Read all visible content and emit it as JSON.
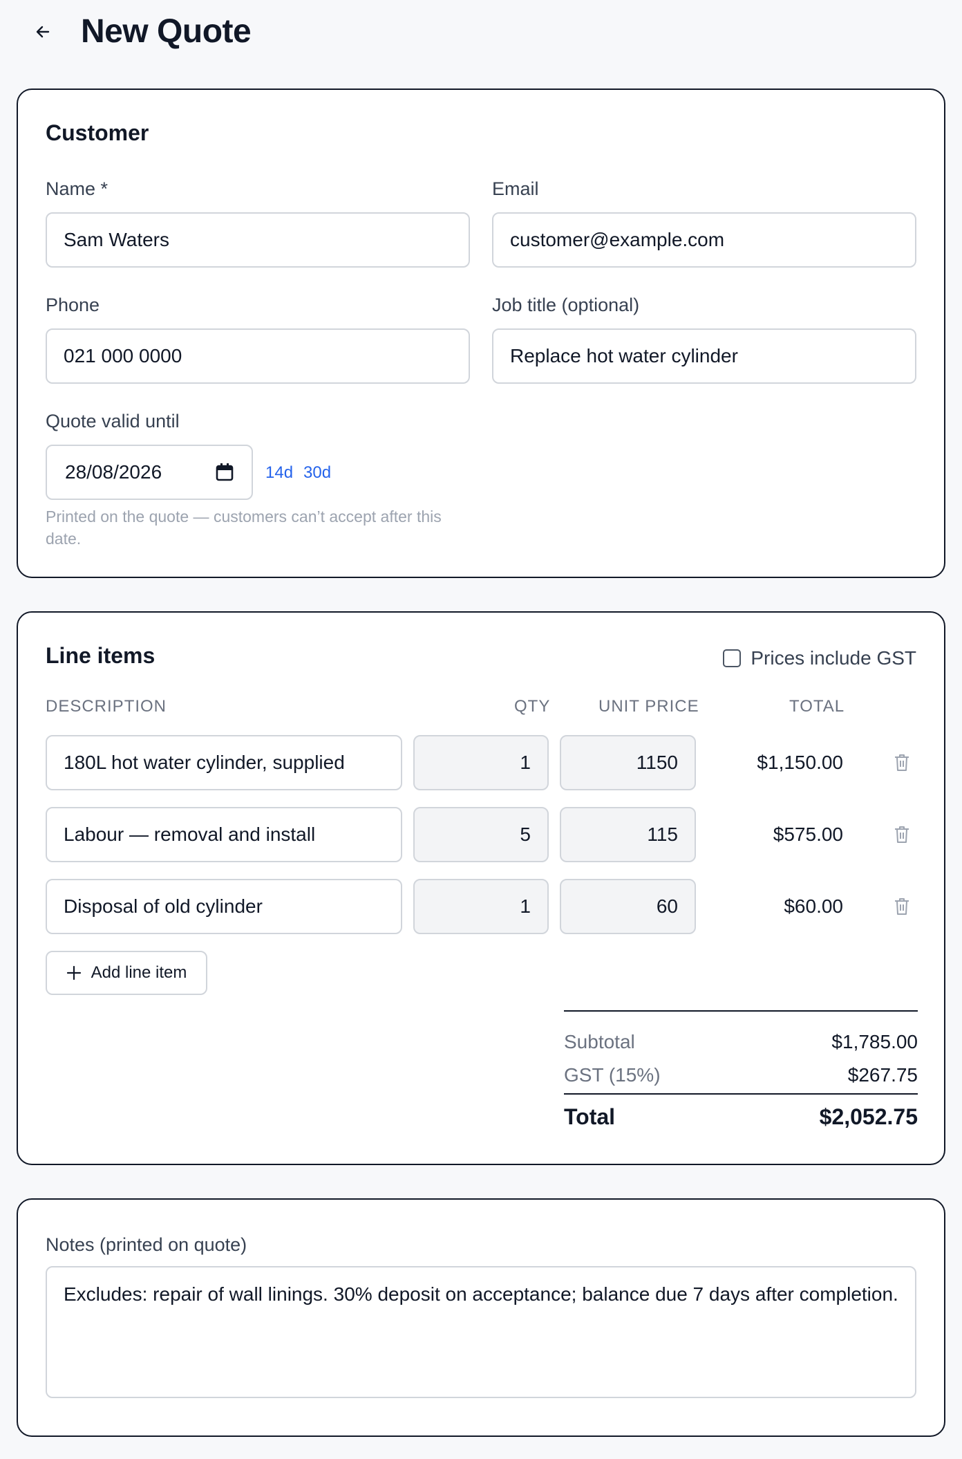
{
  "header": {
    "title": "New Quote"
  },
  "customer": {
    "section_title": "Customer",
    "name": {
      "label": "Name *",
      "value": "Sam Waters"
    },
    "email": {
      "label": "Email",
      "value": "customer@example.com"
    },
    "phone": {
      "label": "Phone",
      "value": "021 000 0000"
    },
    "job_title": {
      "label": "Job title (optional)",
      "value": "Replace hot water cylinder"
    },
    "valid_until": {
      "label": "Quote valid until",
      "value": "28/08/2026",
      "quick_links": [
        "14d",
        "30d"
      ],
      "help_line1": "Printed on the quote — customers can’t accept after this",
      "help_line2": "date."
    }
  },
  "line_items": {
    "section_title": "Line items",
    "gst_toggle_label": "Prices include GST",
    "gst_included": false,
    "columns": {
      "description": "DESCRIPTION",
      "qty": "QTY",
      "unit_price": "UNIT PRICE",
      "total": "TOTAL"
    },
    "rows": [
      {
        "description": "180L hot water cylinder, supplied",
        "qty": "1",
        "unit_price": "1150",
        "total": "$1,150.00"
      },
      {
        "description": "Labour — removal and install",
        "qty": "5",
        "unit_price": "115",
        "total": "$575.00"
      },
      {
        "description": "Disposal of old cylinder",
        "qty": "1",
        "unit_price": "60",
        "total": "$60.00"
      }
    ],
    "add_label": "Add line item",
    "totals": {
      "subtotal_label": "Subtotal",
      "subtotal_value": "$1,785.00",
      "gst_label": "GST (15%)",
      "gst_value": "$267.75",
      "total_label": "Total",
      "total_value": "$2,052.75"
    }
  },
  "notes": {
    "label": "Notes (printed on quote)",
    "value": "Excludes: repair of wall linings. 30% deposit on acceptance; balance due 7 days after completion."
  },
  "icons": {
    "back": "arrow-left-icon",
    "calendar": "calendar-icon",
    "trash": "trash-icon",
    "plus": "plus-icon"
  }
}
